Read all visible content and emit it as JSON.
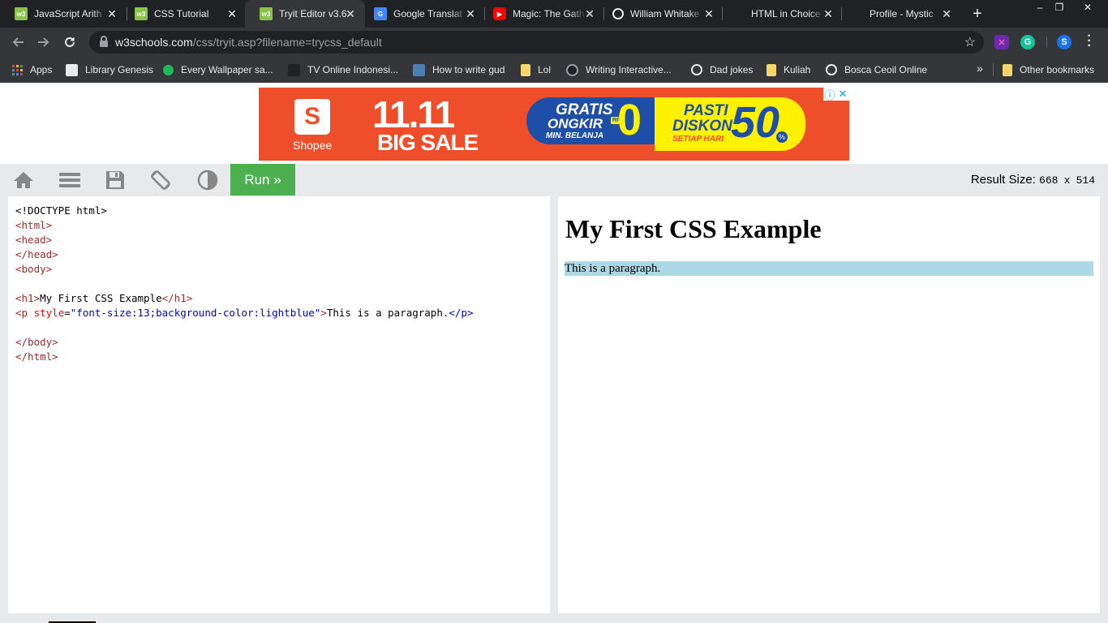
{
  "browser": {
    "tabs": [
      {
        "title": "JavaScript Arith",
        "favicon": "w3-icon"
      },
      {
        "title": "CSS Tutorial",
        "favicon": "w3-icon"
      },
      {
        "title": "Tryit Editor v3.6",
        "favicon": "w3-icon",
        "active": true
      },
      {
        "title": "Google Translat",
        "favicon": "translate-icon"
      },
      {
        "title": "Magic: The Gath",
        "favicon": "youtube-icon"
      },
      {
        "title": "William Whitake",
        "favicon": "globe-icon"
      },
      {
        "title": "HTML in Choice",
        "favicon": "none"
      },
      {
        "title": "Profile - Mystic",
        "favicon": "none"
      }
    ],
    "new_tab": "+",
    "window_controls": [
      "–",
      "❐",
      "✕"
    ],
    "address": {
      "host": "w3schools.com",
      "path": "/css/tryit.asp?filename=trycss_default"
    },
    "bookmarks": [
      {
        "label": "Apps",
        "icon": "apps-grid-icon"
      },
      {
        "label": "Library Genesis",
        "icon": "book-icon"
      },
      {
        "label": "Every Wallpaper sa...",
        "icon": "green-dot-icon"
      },
      {
        "label": "TV Online Indonesi...",
        "icon": "tv-icon"
      },
      {
        "label": "How to write gud",
        "icon": "page-icon"
      },
      {
        "label": "Lol",
        "icon": "folder-icon"
      },
      {
        "label": "Writing Interactive...",
        "icon": "circle-icon"
      },
      {
        "label": "Dad jokes",
        "icon": "globe-icon"
      },
      {
        "label": "Kuliah",
        "icon": "folder-icon"
      },
      {
        "label": "Bosca Ceoil Online",
        "icon": "globe-icon"
      }
    ],
    "other_bookmarks": "Other bookmarks",
    "overflow": "»",
    "extensions": [
      "ext-x-icon",
      "grammarly-icon",
      "s-icon"
    ]
  },
  "ad": {
    "brand": "Shopee",
    "headline": "11.11",
    "subheadline": "BIG SALE",
    "offer1_line1": "GRATIS",
    "offer1_line2": "ONGKIR",
    "offer1_line3": "MIN. BELANJA",
    "offer1_value": "0",
    "offer1_currency": "RP",
    "offer2_line1": "PASTI",
    "offer2_line2": "DISKON",
    "offer2_line3": "SETIAP HARI",
    "offer2_value": "50",
    "offer2_percent": "%",
    "adchoices": "ⓘ",
    "ad_close": "✕"
  },
  "tryit": {
    "run_label": "Run »",
    "result_size_label": "Result Size:",
    "result_width": "668",
    "result_sep": "x",
    "result_height": "514",
    "tools": [
      "home-icon",
      "menu-icon",
      "save-icon",
      "rotate-icon",
      "contrast-icon"
    ]
  },
  "editor": {
    "doctype": "<!DOCTYPE html>",
    "html_open": "<html>",
    "head_open": "<head>",
    "head_close": "</head>",
    "body_open": "<body>",
    "h1_open": "<h1>",
    "h1_text": "My First CSS Example",
    "h1_close": "</h1>",
    "p_open_start": "<p",
    "p_attr": "style",
    "p_eq": "=",
    "p_value": "\"font-size:13;background-color:lightblue\"",
    "p_open_end": ">",
    "p_text": "This is a paragraph.",
    "p_close": "</p>",
    "body_close": "</body>",
    "html_close": "</html>"
  },
  "result": {
    "heading": "My First CSS Example",
    "paragraph": "This is a paragraph."
  },
  "colors": {
    "run_button": "#4caf50",
    "paragraph_bg": "#add8e6",
    "chrome_dark": "#202124",
    "toolbar": "#35363a"
  }
}
